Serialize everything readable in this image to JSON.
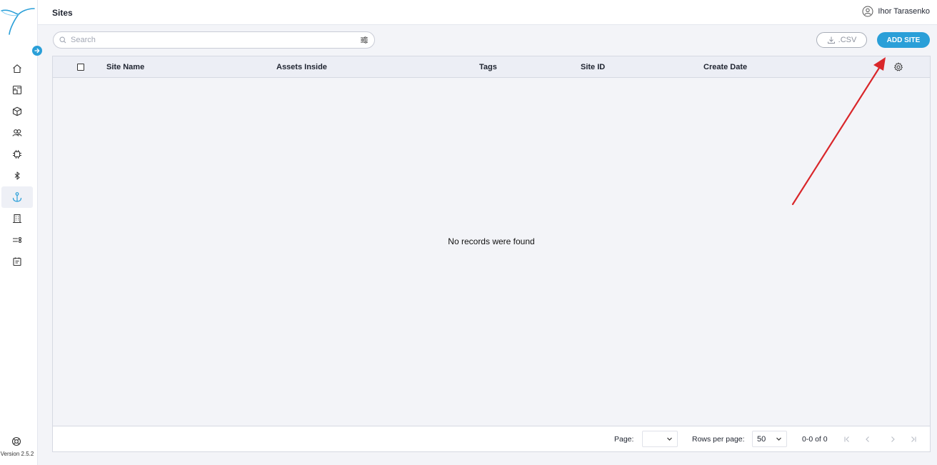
{
  "header": {
    "title": "Sites",
    "user_name": "Ihor Tarasenko"
  },
  "sidebar": {
    "items": [
      {
        "name": "home-icon",
        "active": false
      },
      {
        "name": "dashboard-icon",
        "active": false
      },
      {
        "name": "box-icon",
        "active": false
      },
      {
        "name": "users-icon",
        "active": false
      },
      {
        "name": "chip-icon",
        "active": false
      },
      {
        "name": "bluetooth-icon",
        "active": false
      },
      {
        "name": "anchor-icon",
        "active": true
      },
      {
        "name": "building-icon",
        "active": false
      },
      {
        "name": "toggle-list-icon",
        "active": false
      },
      {
        "name": "report-icon",
        "active": false
      }
    ],
    "version": "Version 2.5.2"
  },
  "toolbar": {
    "search_placeholder": "Search",
    "csv_label": ".CSV",
    "add_label": "ADD SITE"
  },
  "table": {
    "columns": [
      "Site Name",
      "Assets Inside",
      "Tags",
      "Site ID",
      "Create Date"
    ],
    "empty_message": "No records were found"
  },
  "pagination": {
    "page_label": "Page:",
    "page_value": "",
    "rows_label": "Rows per page:",
    "rows_value": "50",
    "range": "0-0 of 0"
  },
  "colors": {
    "accent": "#2a9fd8",
    "annotation_arrow": "#d9262a"
  }
}
